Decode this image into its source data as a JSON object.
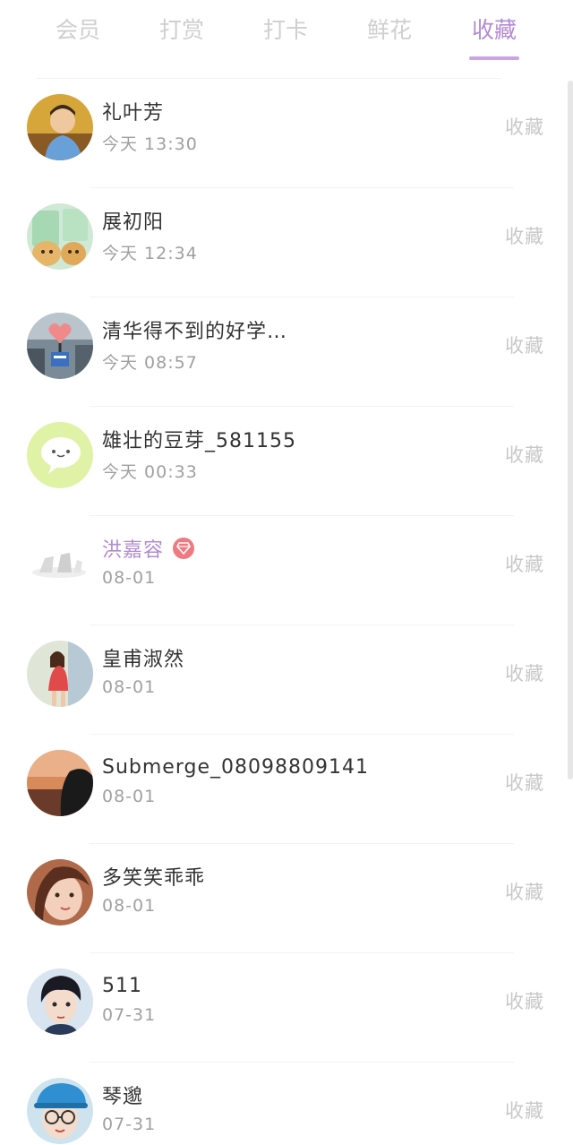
{
  "tabs": [
    {
      "label": "会员",
      "active": false
    },
    {
      "label": "打赏",
      "active": false
    },
    {
      "label": "打卡",
      "active": false
    },
    {
      "label": "鲜花",
      "active": false
    },
    {
      "label": "收藏",
      "active": true
    }
  ],
  "colors": {
    "accent": "#b28bd3",
    "inactive_tab": "#cfcfcf",
    "name": "#333333",
    "time": "#a0a0a0",
    "action": "#c8c8c8",
    "vip_badge": "#f07a82"
  },
  "list": [
    {
      "name": "礼叶芳",
      "time": "今天 13:30",
      "action": "收藏",
      "vip": false,
      "avatar": "photo-boy-yellow-icon"
    },
    {
      "name": "展初阳",
      "time": "今天 12:34",
      "action": "收藏",
      "vip": false,
      "avatar": "cartoon-avatar-icon"
    },
    {
      "name": "清华得不到的好学…",
      "time": "今天 08:57",
      "action": "收藏",
      "vip": false,
      "avatar": "heart-sign-photo-icon"
    },
    {
      "name": "雄壮的豆芽_581155",
      "time": "今天 00:33",
      "action": "收藏",
      "vip": false,
      "avatar": "chat-bubble-avatar-icon"
    },
    {
      "name": "洪嘉容",
      "time": "08-01",
      "action": "收藏",
      "vip": true,
      "avatar": "faded-sketch-avatar-icon",
      "badge_icon": "diamond-icon"
    },
    {
      "name": "皇甫淑然",
      "time": "08-01",
      "action": "收藏",
      "vip": false,
      "avatar": "photo-girl-red-icon"
    },
    {
      "name": "Submerge_08098809141",
      "time": "08-01",
      "action": "收藏",
      "vip": false,
      "avatar": "photo-sunset-silhouette-icon"
    },
    {
      "name": "多笑笑乖乖",
      "time": "08-01",
      "action": "收藏",
      "vip": false,
      "avatar": "photo-girl-closeup-icon"
    },
    {
      "name": "511",
      "time": "07-31",
      "action": "收藏",
      "vip": false,
      "avatar": "photo-boy-dark-hair-icon"
    },
    {
      "name": "琴邈",
      "time": "07-31",
      "action": "收藏",
      "vip": false,
      "avatar": "photo-boy-cap-glasses-icon"
    }
  ]
}
